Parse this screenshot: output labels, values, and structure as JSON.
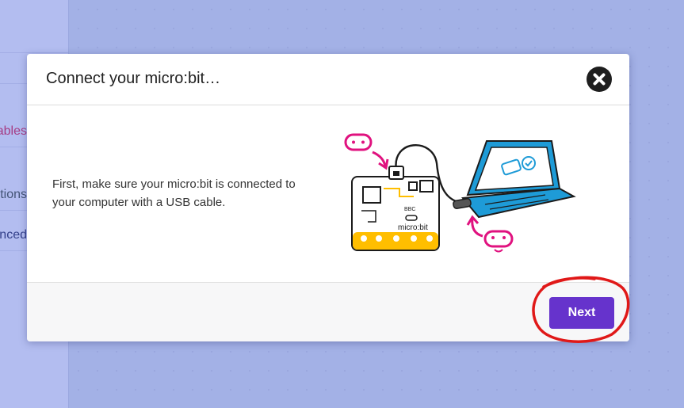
{
  "sidebar": {
    "items": [
      {
        "label": "Variables"
      },
      {
        "label": "Functions"
      },
      {
        "label": "Advanced"
      }
    ]
  },
  "modal": {
    "title": "Connect your micro:bit…",
    "body_text": "First, make sure your micro:bit is connected to your computer with a USB cable.",
    "close_icon": "close-icon",
    "next_label": "Next",
    "board_badge": "BBC",
    "board_label": "micro:bit",
    "colors": {
      "accent": "#6633cc",
      "annotation": "#e01818",
      "character": "#e0127f",
      "laptop": "#1e9bd7",
      "board_edge": "#ffbe00"
    }
  }
}
